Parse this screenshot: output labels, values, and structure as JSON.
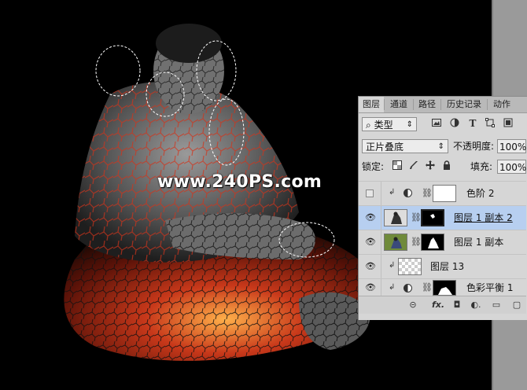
{
  "watermark": "www.240PS.com",
  "panel": {
    "tabs": [
      {
        "label": "图层",
        "active": true
      },
      {
        "label": "通道",
        "active": false
      },
      {
        "label": "路径",
        "active": false
      },
      {
        "label": "历史记录",
        "active": false
      },
      {
        "label": "动作",
        "active": false
      }
    ],
    "filter": {
      "search_glyph": "⌕",
      "type_label": "类型",
      "arrows": "⇕",
      "icons": [
        "image-filter-icon",
        "adjustment-filter-icon",
        "type-filter-icon",
        "shape-filter-icon",
        "smart-object-filter-icon"
      ],
      "type_glyph": "T"
    },
    "blend_mode": "正片叠底",
    "opacity_label": "不透明度:",
    "opacity_value": "100%",
    "lock_label": "锁定:",
    "fill_label": "填充:",
    "fill_value": "100%",
    "layers": [
      {
        "name": "色阶 2",
        "visible": false,
        "selected": false
      },
      {
        "name": "图层 1 副本 2",
        "visible": true,
        "selected": true
      },
      {
        "name": "图层 1 副本",
        "visible": true,
        "selected": false
      },
      {
        "name": "图层 13",
        "visible": true,
        "selected": false
      },
      {
        "name": "色彩平衡 1",
        "visible": true,
        "selected": false
      }
    ],
    "footer": {
      "link": "⊝",
      "fx": "fx.",
      "mask": "◘",
      "adjust": "◐.",
      "folder": "▭",
      "new": "▢"
    },
    "glyphs": {
      "eye": "👁",
      "clip": "↲",
      "chain": "⛓"
    }
  },
  "colors": {
    "panel_bg": "#d6d6d6",
    "selected_row": "#b7cff0",
    "canvas_bg": "#000000",
    "workspace": "#9a9a9a"
  }
}
